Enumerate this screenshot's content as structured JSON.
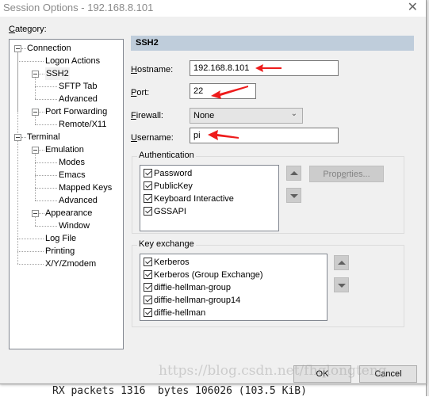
{
  "window": {
    "title": "Session Options - 192.168.8.101",
    "close_glyph": "✕"
  },
  "category": {
    "label_accel": "C",
    "label_rest": "ategory:",
    "tree": [
      {
        "label": "Connection",
        "level": 0,
        "expanded": true
      },
      {
        "label": "Logon Actions",
        "level": 1
      },
      {
        "label": "SSH2",
        "level": 1,
        "expanded": true,
        "selected": true
      },
      {
        "label": "SFTP Tab",
        "level": 2
      },
      {
        "label": "Advanced",
        "level": 2
      },
      {
        "label": "Port Forwarding",
        "level": 1,
        "expanded": true
      },
      {
        "label": "Remote/X11",
        "level": 2
      },
      {
        "label": "Terminal",
        "level": 0,
        "expanded": true
      },
      {
        "label": "Emulation",
        "level": 1,
        "expanded": true
      },
      {
        "label": "Modes",
        "level": 2
      },
      {
        "label": "Emacs",
        "level": 2
      },
      {
        "label": "Mapped Keys",
        "level": 2
      },
      {
        "label": "Advanced",
        "level": 2
      },
      {
        "label": "Appearance",
        "level": 1,
        "expanded": true
      },
      {
        "label": "Window",
        "level": 2
      },
      {
        "label": "Log File",
        "level": 1
      },
      {
        "label": "Printing",
        "level": 1
      },
      {
        "label": "X/Y/Zmodem",
        "level": 1
      }
    ]
  },
  "panel": {
    "header": "SSH2",
    "hostname": {
      "accel": "H",
      "rest": "ostname:",
      "value": "192.168.8.101"
    },
    "port": {
      "accel": "P",
      "rest": "ort:",
      "value": "22"
    },
    "firewall": {
      "accel": "F",
      "rest": "irewall:",
      "value": "None"
    },
    "username": {
      "accel": "U",
      "rest": "sername:",
      "value": "pi"
    },
    "authentication": {
      "legend": "Authentication",
      "items": [
        {
          "label": "Password",
          "checked": true
        },
        {
          "label": "PublicKey",
          "checked": true
        },
        {
          "label": "Keyboard Interactive",
          "checked": true
        },
        {
          "label": "GSSAPI",
          "checked": true
        }
      ],
      "properties_pre": "Prop",
      "properties_accel": "e",
      "properties_post": "rties..."
    },
    "key_exchange": {
      "legend": "Key exchange",
      "items": [
        {
          "label": "Kerberos",
          "checked": true
        },
        {
          "label": "Kerberos (Group Exchange)",
          "checked": true
        },
        {
          "label": "diffie-hellman-group",
          "checked": true
        },
        {
          "label": "diffie-hellman-group14",
          "checked": true
        },
        {
          "label": "diffie-hellman",
          "checked": true
        }
      ]
    }
  },
  "buttons": {
    "ok": "OK",
    "cancel": "Cancel"
  },
  "annotation_color": "#ee1c1c",
  "background_terminal_text": "RX packets 1316  bytes 106026 (103.5 KiB)",
  "watermark": "https://blog.csdn.net/fhqlongteng"
}
